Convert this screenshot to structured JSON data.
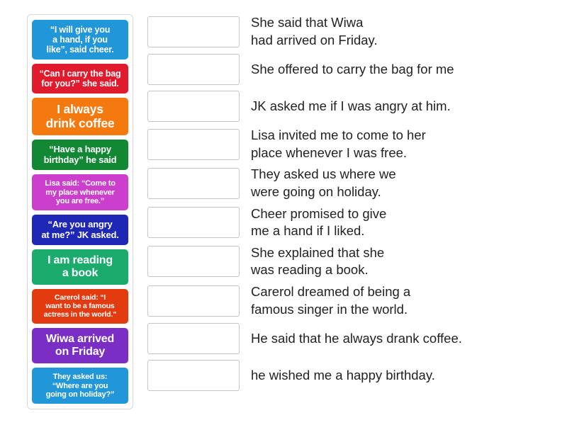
{
  "activity": {
    "type": "match-up",
    "colors": {
      "tile_blue_light": "#2196d8",
      "tile_red": "#e01b2e",
      "tile_orange": "#f47a0f",
      "tile_green_dark": "#128734",
      "tile_magenta": "#cc3ecc",
      "tile_blue_dark": "#1f27b5",
      "tile_green_emerald": "#1bab6d",
      "tile_vermilion": "#e23b10",
      "tile_purple": "#7a2ec4",
      "tile_sky": "#2196d8",
      "text_on_tile": "#ffffff",
      "answer_text": "#222222",
      "box_border": "#c4c4c4",
      "panel_border": "#d8d8d8"
    },
    "tiles": [
      {
        "id": "tile-1",
        "text": "“I will give you\na hand, if you\nlike”, said cheer.",
        "color": "#2196d8",
        "size": "fs-12"
      },
      {
        "id": "tile-2",
        "text": "“Can I carry the bag\nfor you?” she said.",
        "color": "#e01b2e",
        "size": "fs-12"
      },
      {
        "id": "tile-3",
        "text": "I always\ndrink coffee",
        "color": "#f47a0f",
        "size": "fs-17"
      },
      {
        "id": "tile-4",
        "text": "“Have a happy\nbirthday” he said",
        "color": "#128734",
        "size": "fs-13"
      },
      {
        "id": "tile-5",
        "text": "Lisa said: “Come to\nmy place whenever\nyou are free.”",
        "color": "#cc3ecc",
        "size": "fs-11"
      },
      {
        "id": "tile-6",
        "text": "“Are you angry\nat me?” JK asked.",
        "color": "#1f27b5",
        "size": "fs-13"
      },
      {
        "id": "tile-7",
        "text": "I am reading\na book",
        "color": "#1bab6d",
        "size": "fs-16"
      },
      {
        "id": "tile-8",
        "text": "Carerol said: “I\nwant to be a famous\nactress in the world.”",
        "color": "#e23b10",
        "size": "fs-10"
      },
      {
        "id": "tile-9",
        "text": "Wiwa arrived\non Friday",
        "color": "#7a2ec4",
        "size": "fs-16"
      },
      {
        "id": "tile-10",
        "text": "They asked us:\n“Where are you\ngoing on holiday?”",
        "color": "#2196d8",
        "size": "fs-11"
      }
    ],
    "answers": [
      {
        "id": "answer-1",
        "drop_value": "",
        "text": "She said that Wiwa\nhad arrived on Friday."
      },
      {
        "id": "answer-2",
        "drop_value": "",
        "text": "She offered to carry the bag for me"
      },
      {
        "id": "answer-3",
        "drop_value": "",
        "text": "JK asked me if I was angry at him."
      },
      {
        "id": "answer-4",
        "drop_value": "",
        "text": "Lisa invited me to come to her\nplace whenever I was free."
      },
      {
        "id": "answer-5",
        "drop_value": "",
        "text": "They asked us where we\nwere going on holiday."
      },
      {
        "id": "answer-6",
        "drop_value": "",
        "text": "Cheer promised to give\nme a hand if I liked."
      },
      {
        "id": "answer-7",
        "drop_value": "",
        "text": "She explained that she\nwas reading a book."
      },
      {
        "id": "answer-8",
        "drop_value": "",
        "text": "Carerol dreamed of being a\nfamous singer in the world."
      },
      {
        "id": "answer-9",
        "drop_value": "",
        "text": "He said that he always drank coffee."
      },
      {
        "id": "answer-10",
        "drop_value": "",
        "text": "he wished me a happy birthday."
      }
    ]
  }
}
